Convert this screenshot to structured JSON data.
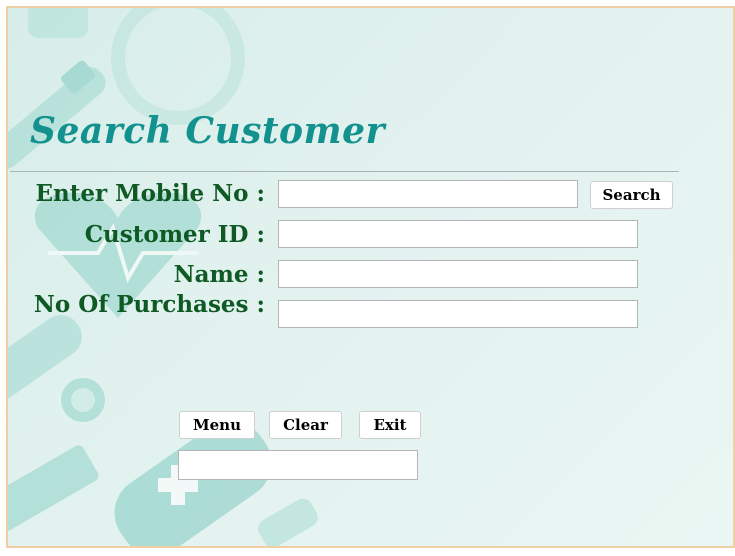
{
  "form": {
    "title": "Search Customer",
    "labels": {
      "mobile": "Enter Mobile No :",
      "customer_id": "Customer ID :",
      "name": "Name :",
      "purchases": "No Of Purchases :"
    },
    "fields": {
      "mobile": "",
      "customer_id": "",
      "name": "",
      "purchases": "",
      "status": ""
    },
    "buttons": {
      "search": "Search",
      "menu": "Menu",
      "clear": "Clear",
      "exit": "Exit"
    }
  },
  "colors": {
    "title": "#12918f",
    "label": "#0f5a24",
    "background": "#dff0ec",
    "frame_border": "#f0cfa6"
  }
}
